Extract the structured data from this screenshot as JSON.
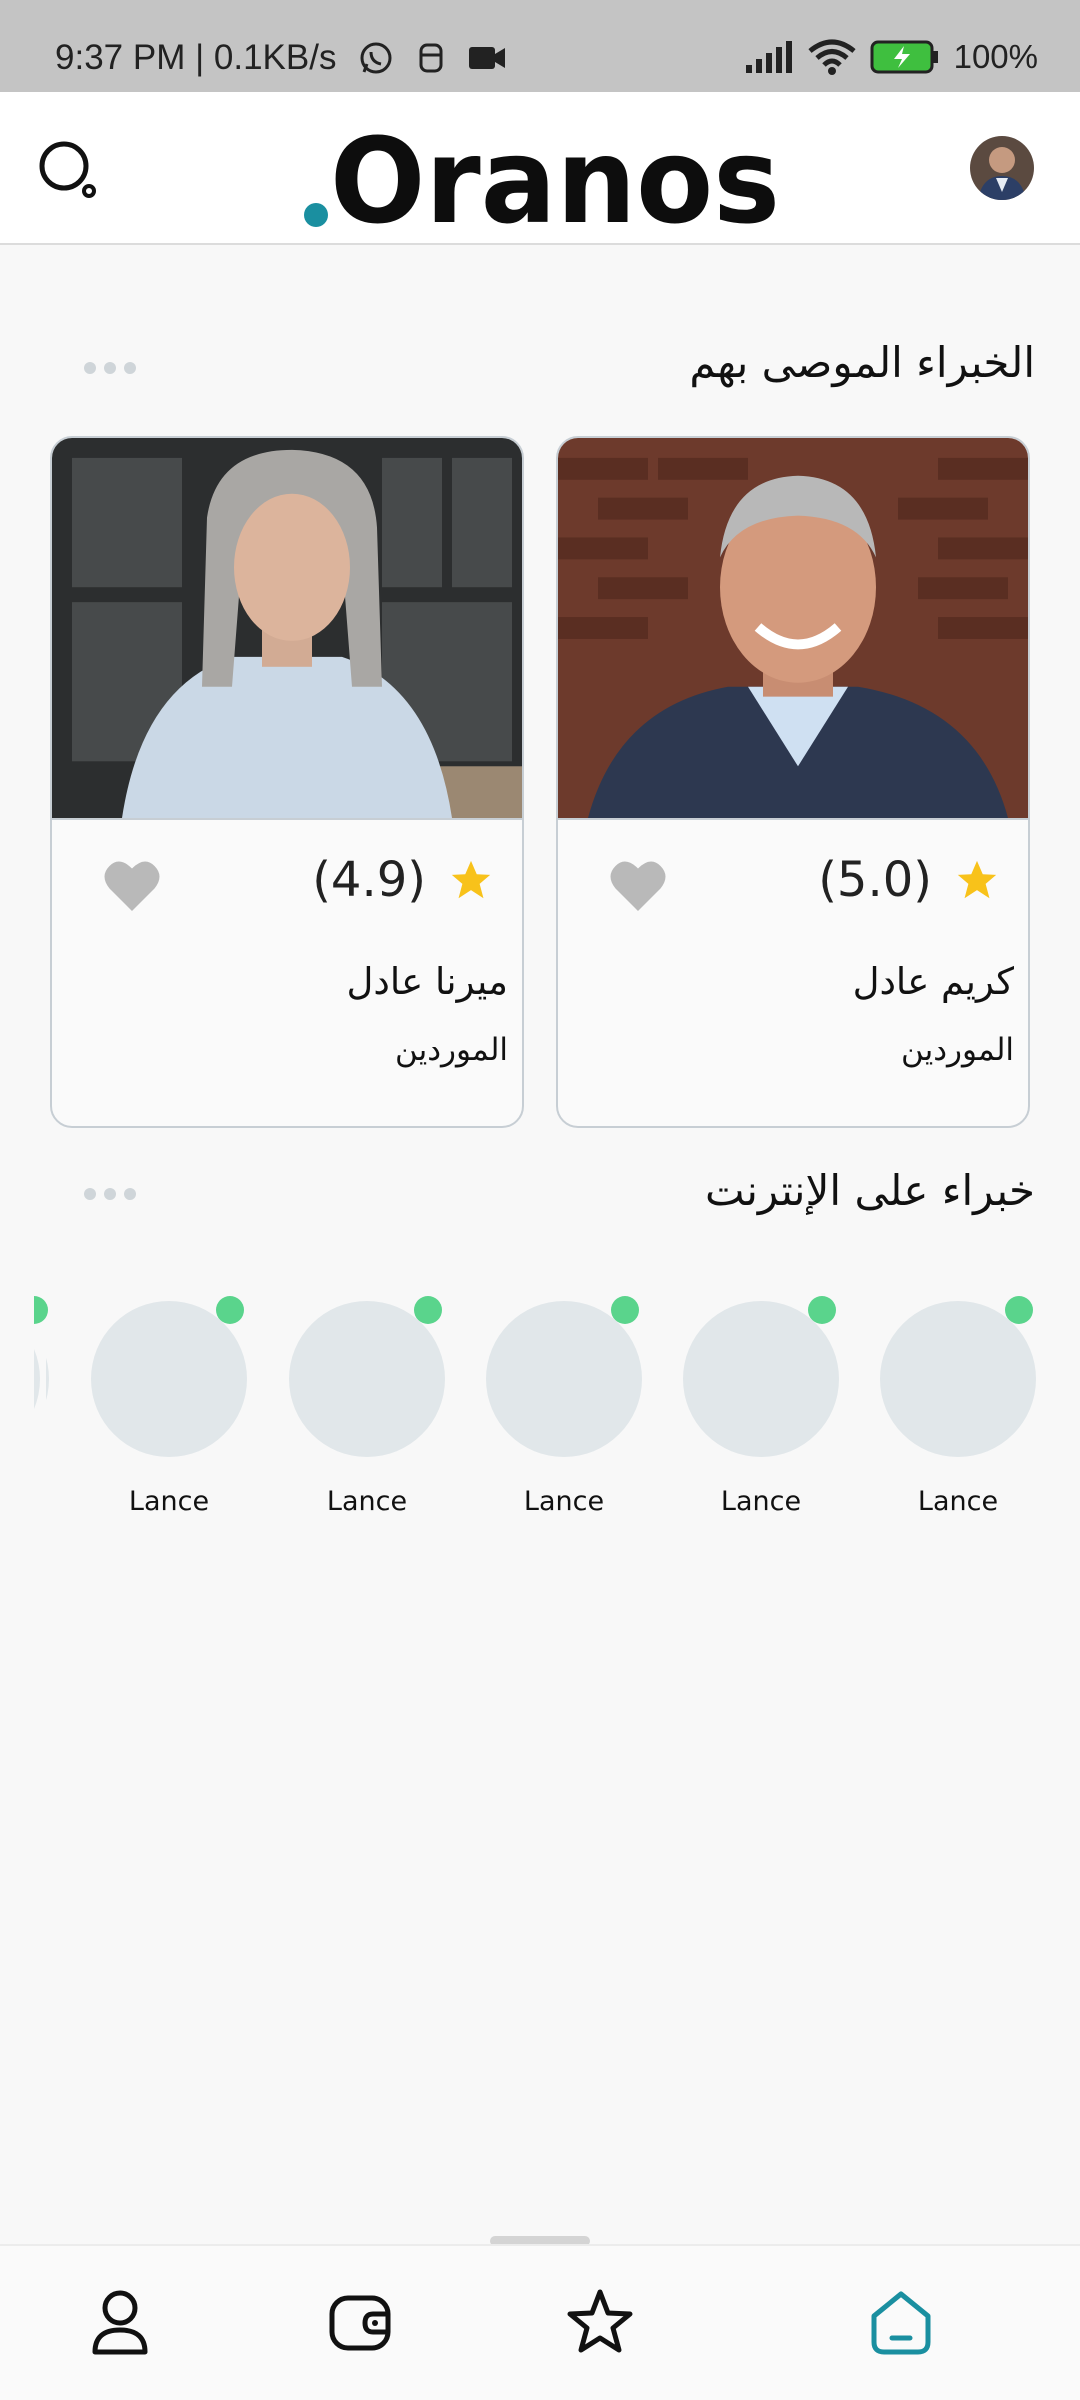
{
  "status_bar": {
    "time_speed": "9:37 PM | 0.1KB/s",
    "battery": "100%"
  },
  "header": {
    "logo_text": "Oranos",
    "logo_dot_color": "#1a8fa0"
  },
  "recommended": {
    "title": "الخبراء الموصى بهم",
    "experts": [
      {
        "name": "كريم عادل",
        "location": "الموردين",
        "rating": "(5.0)"
      },
      {
        "name": "ميرنا عادل",
        "location": "الموردين",
        "rating": "(4.9)"
      }
    ]
  },
  "online": {
    "title": "خبراء على الإنترنت",
    "experts": [
      {
        "name": "Lance"
      },
      {
        "name": "Lance"
      },
      {
        "name": "Lance"
      },
      {
        "name": "Lance"
      },
      {
        "name": "Lance"
      }
    ]
  },
  "nav": {
    "active_color": "#1a8fa0",
    "items": [
      "profile-icon",
      "wallet-icon",
      "favorites-icon",
      "home-icon"
    ]
  }
}
